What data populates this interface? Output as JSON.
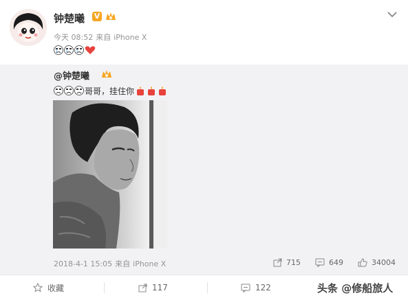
{
  "author": {
    "name": "钟楚曦",
    "badge_letter": "V"
  },
  "post": {
    "time": "今天 08:52",
    "source_prefix": "来自",
    "device": "iPhone X"
  },
  "repost": {
    "author": "@钟楚曦",
    "text": "哥哥，挂住你",
    "time": "2018-4-1 15:05",
    "source_prefix": "来自",
    "device": "iPhone X",
    "stats": {
      "reposts": "715",
      "comments": "649",
      "likes": "34004"
    }
  },
  "footer": {
    "favorite_label": "收藏",
    "repost_count": "117",
    "comment_count": "122"
  },
  "watermark": "头条 @修船旅人",
  "colors": {
    "meta_gray": "#939393",
    "repost_bg": "#f2f2f5",
    "verified_orange": "#f5a623",
    "heart_red": "#e8423d"
  },
  "icons": [
    "chevron-down-icon",
    "verified-icon",
    "vip-icon",
    "heart-icon",
    "crying-emoji-icon",
    "candle-emoji-icon",
    "repost-icon",
    "comment-icon",
    "like-icon",
    "star-icon"
  ]
}
